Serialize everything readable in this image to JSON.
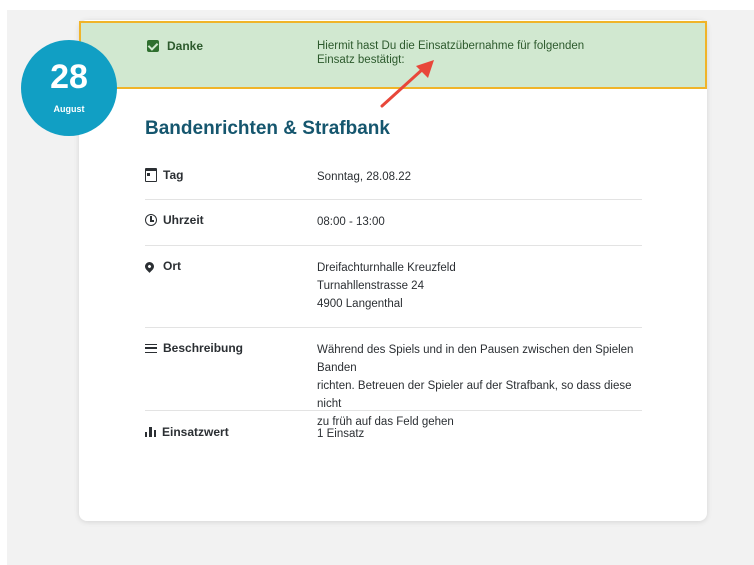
{
  "alert": {
    "label": "Danke",
    "message": "Hiermit hast Du die Einsatzübernahme für folgenden Einsatz bestätigt:"
  },
  "date_badge": {
    "day": "28",
    "month": "August"
  },
  "event": {
    "title": "Bandenrichten & Strafbank",
    "rows": [
      {
        "icon": "calendar-icon",
        "label": "Tag",
        "value_lines": [
          "Sonntag, 28.08.22"
        ]
      },
      {
        "icon": "clock-icon",
        "label": "Uhrzeit",
        "value_lines": [
          "08:00 - 13:00"
        ]
      },
      {
        "icon": "location-pin-icon",
        "label": "Ort",
        "value_lines": [
          "Dreifachturnhalle Kreuzfeld",
          "Turnahllenstrasse 24",
          "4900 Langenthal"
        ]
      },
      {
        "icon": "description-lines-icon",
        "label": "Beschreibung",
        "value_lines": [
          "Während des Spiels und in den Pausen zwischen den Spielen Banden",
          "richten. Betreuen der Spieler auf der Strafbank, so dass diese nicht",
          "zu früh auf das Feld gehen"
        ]
      },
      {
        "icon": "bar-chart-icon",
        "label": "Einsatzwert",
        "value_lines": [
          "1 Einsatz"
        ]
      }
    ]
  },
  "colors": {
    "alert_bg": "#d1e8d0",
    "alert_border": "#f0b429",
    "badge": "#119fc4",
    "title": "#15566e",
    "arrow": "#e8473a"
  }
}
